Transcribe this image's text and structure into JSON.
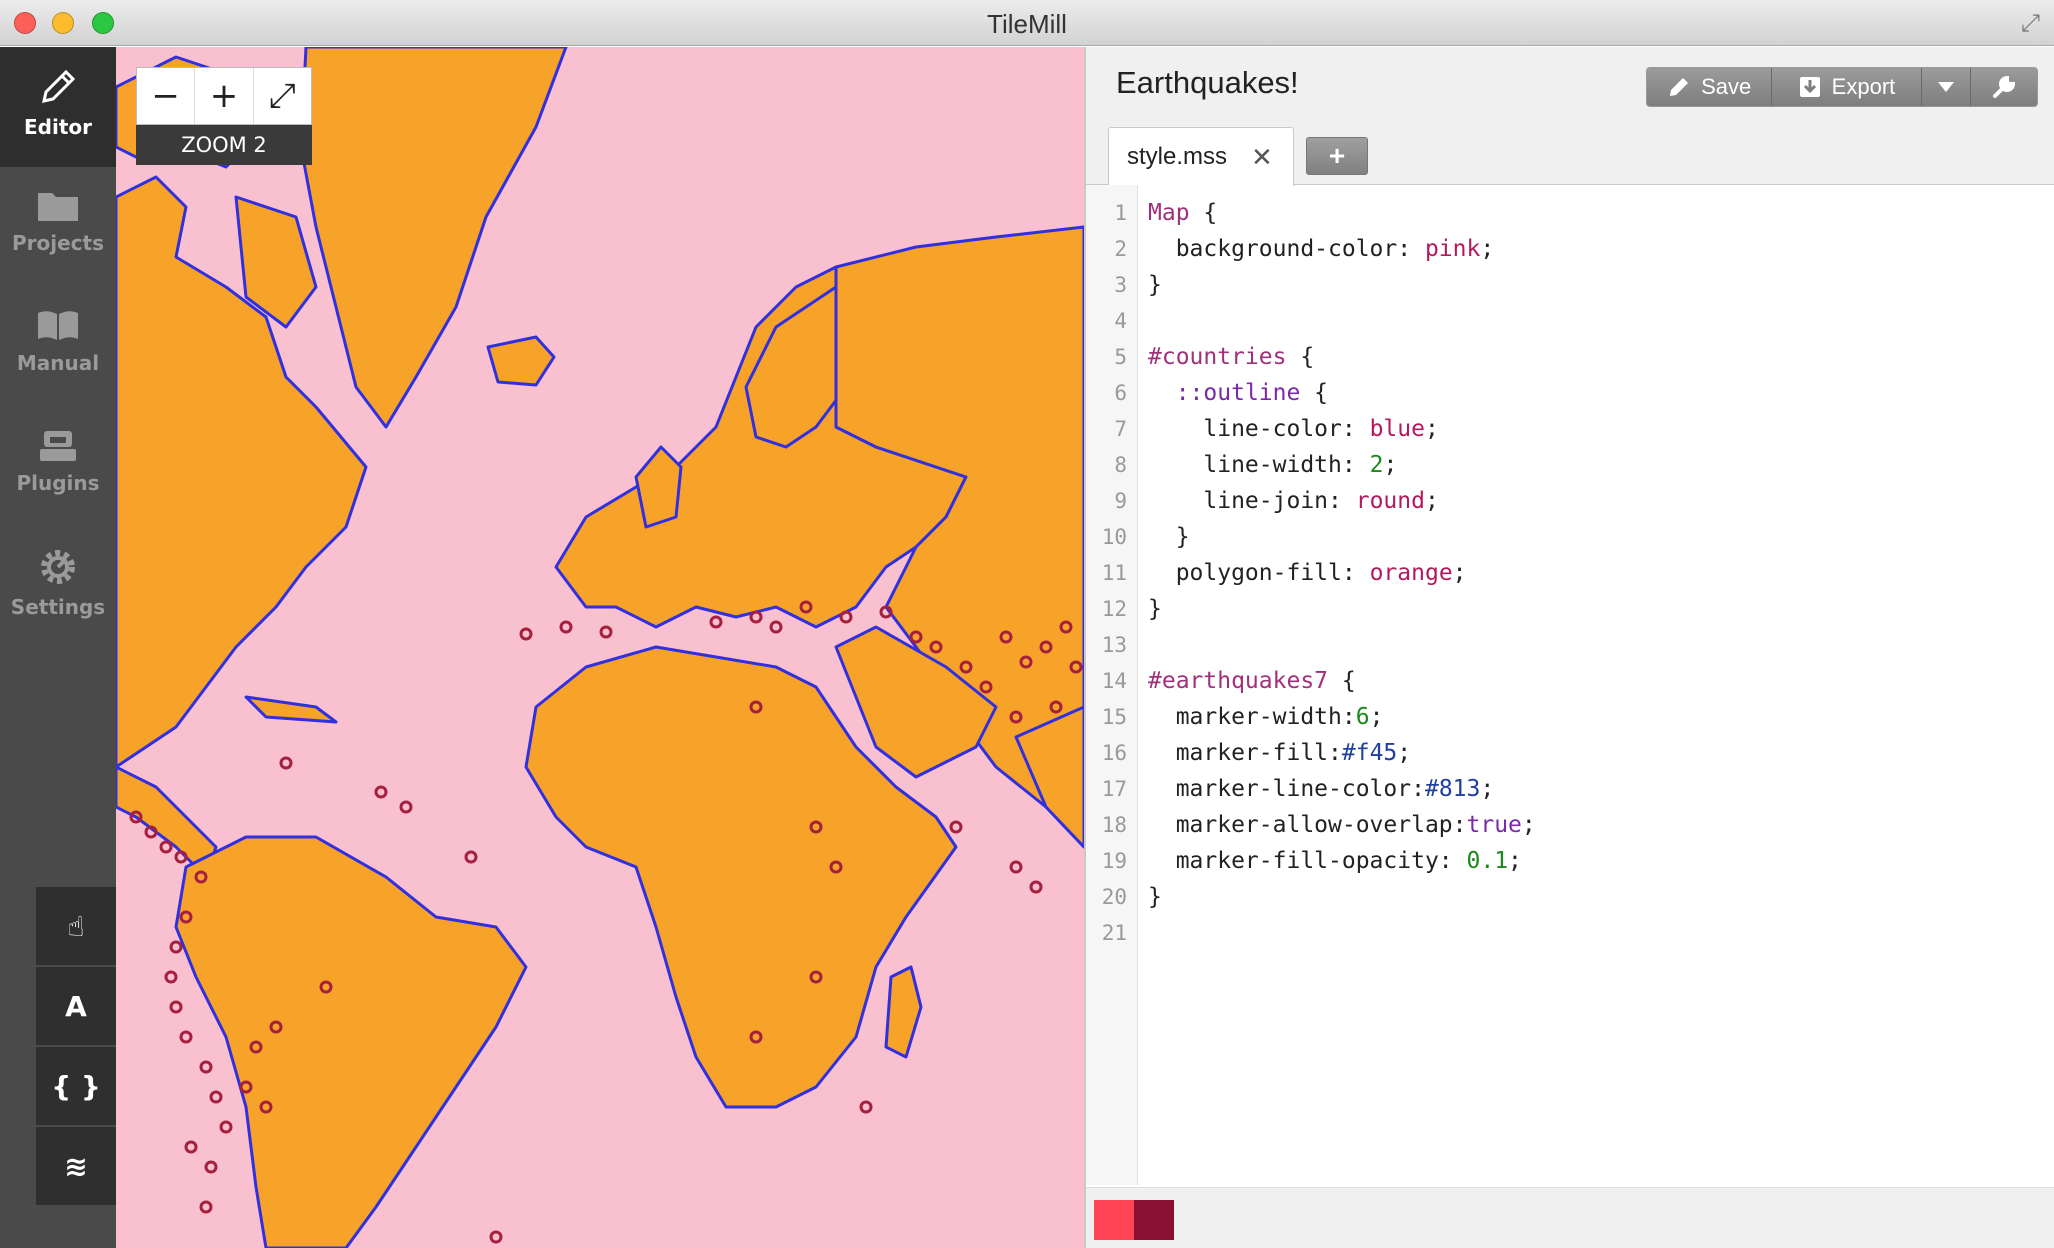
{
  "window": {
    "title": "TileMill"
  },
  "sidebar": {
    "items": [
      {
        "label": "Editor",
        "icon": "pencil-icon",
        "active": true
      },
      {
        "label": "Projects",
        "icon": "folder-icon"
      },
      {
        "label": "Manual",
        "icon": "book-icon"
      },
      {
        "label": "Plugins",
        "icon": "plugin-icon"
      },
      {
        "label": "Settings",
        "icon": "gear-icon"
      }
    ],
    "tools": [
      {
        "glyph": "☝",
        "icon": "hand-icon"
      },
      {
        "glyph": "A",
        "icon": "text-icon"
      },
      {
        "glyph": "{ }",
        "icon": "braces-icon"
      },
      {
        "glyph": "≋",
        "icon": "layers-icon"
      }
    ]
  },
  "map": {
    "zoom_minus": "−",
    "zoom_plus": "+",
    "fullscreen": "⤢",
    "zoom_label": "ZOOM 2",
    "background": "#f9c0cf",
    "land": "#f7a229",
    "outline": "#3030e0",
    "marker": "#a5203e"
  },
  "editor": {
    "project_title": "Earthquakes!",
    "save_label": "Save",
    "export_label": "Export",
    "tab_label": "style.mss",
    "tab_close": "✕",
    "add_tab": "+",
    "lines": [
      [
        [
          "Map",
          "sel"
        ],
        [
          " {",
          "pun"
        ]
      ],
      [
        [
          "  background-color",
          "pr"
        ],
        [
          ": ",
          "pun"
        ],
        [
          "pink",
          "kw"
        ],
        [
          ";",
          "pun"
        ]
      ],
      [
        [
          "}",
          "pun"
        ]
      ],
      [],
      [
        [
          "#countries",
          "sel"
        ],
        [
          " {",
          "pun"
        ]
      ],
      [
        [
          "  ",
          "pr"
        ],
        [
          "::outline",
          "att"
        ],
        [
          " {",
          "pun"
        ]
      ],
      [
        [
          "    line-color",
          "pr"
        ],
        [
          ": ",
          "pun"
        ],
        [
          "blue",
          "kw"
        ],
        [
          ";",
          "pun"
        ]
      ],
      [
        [
          "    line-width",
          "pr"
        ],
        [
          ": ",
          "pun"
        ],
        [
          "2",
          "num"
        ],
        [
          ";",
          "pun"
        ]
      ],
      [
        [
          "    line-join",
          "pr"
        ],
        [
          ": ",
          "pun"
        ],
        [
          "round",
          "kw"
        ],
        [
          ";",
          "pun"
        ]
      ],
      [
        [
          "  }",
          "pun"
        ]
      ],
      [
        [
          "  polygon-fill",
          "pr"
        ],
        [
          ": ",
          "pun"
        ],
        [
          "orange",
          "kw"
        ],
        [
          ";",
          "pun"
        ]
      ],
      [
        [
          "}",
          "pun"
        ]
      ],
      [],
      [
        [
          "#earthquakes7",
          "sel"
        ],
        [
          " {",
          "pun"
        ]
      ],
      [
        [
          "  marker-width",
          "pr"
        ],
        [
          ":",
          "pun"
        ],
        [
          "6",
          "num"
        ],
        [
          ";",
          "pun"
        ]
      ],
      [
        [
          "  marker-fill",
          "pr"
        ],
        [
          ":",
          "pun"
        ],
        [
          "#f45",
          "hex"
        ],
        [
          ";",
          "pun"
        ]
      ],
      [
        [
          "  marker-line-color",
          "pr"
        ],
        [
          ":",
          "pun"
        ],
        [
          "#813",
          "hex"
        ],
        [
          ";",
          "pun"
        ]
      ],
      [
        [
          "  marker-allow-overlap",
          "pr"
        ],
        [
          ":",
          "pun"
        ],
        [
          "true",
          "att"
        ],
        [
          ";",
          "pun"
        ]
      ],
      [
        [
          "  marker-fill-opacity",
          "pr"
        ],
        [
          ": ",
          "pun"
        ],
        [
          "0.1",
          "num"
        ],
        [
          ";",
          "pun"
        ]
      ],
      [
        [
          "}",
          "pun"
        ]
      ],
      []
    ],
    "swatches": [
      "#ff4455",
      "#881133"
    ]
  }
}
